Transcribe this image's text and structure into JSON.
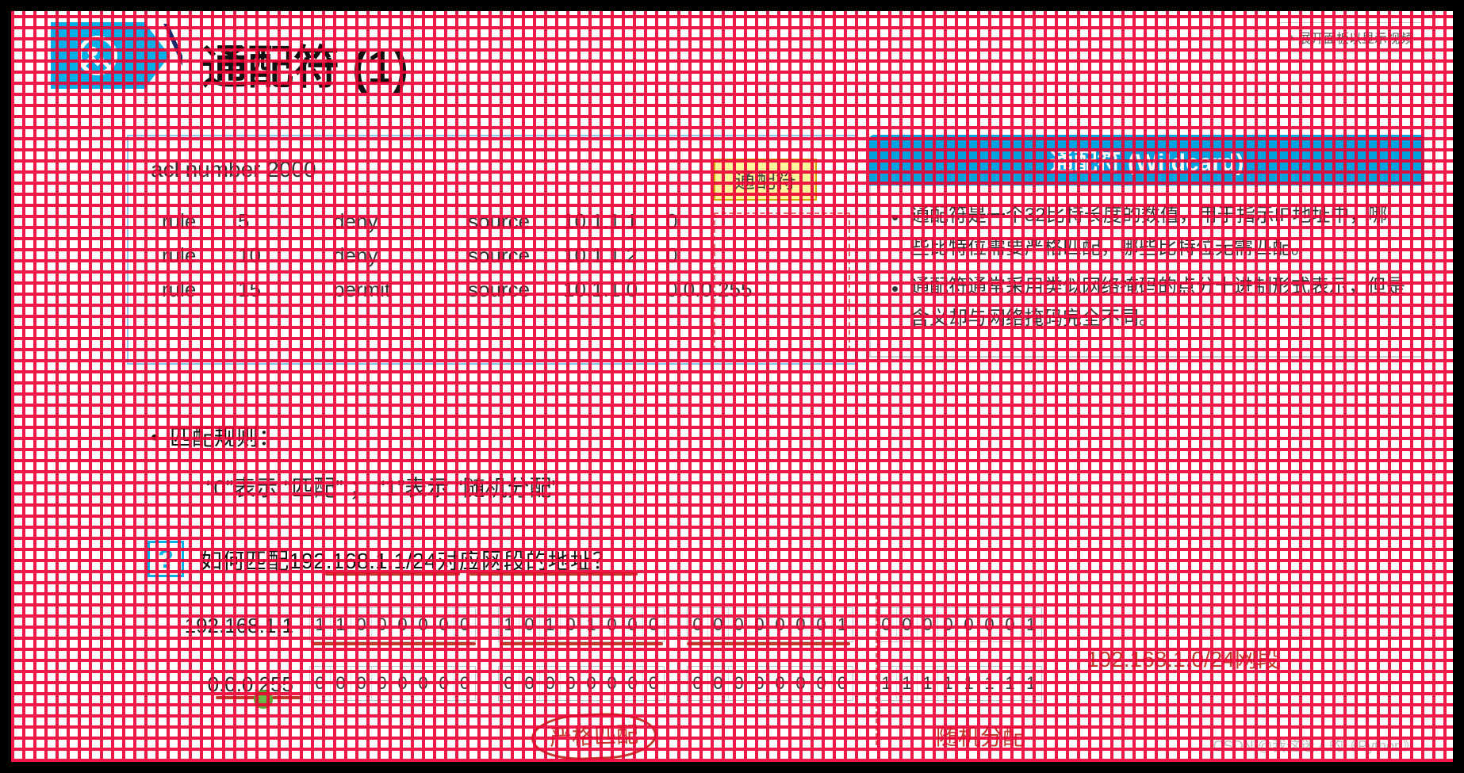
{
  "header": {
    "title": "通配符 (1)",
    "expand_btn": "展开面板以显示视频"
  },
  "acl": {
    "header": "acl number 2000",
    "tag": "通配符",
    "rows": [
      {
        "kw": "rule",
        "id": "5",
        "act": "deny",
        "src": "source",
        "ip": "10.1.1.1",
        "wc": "0"
      },
      {
        "kw": "rule",
        "id": "10",
        "act": "deny",
        "src": "source",
        "ip": "10.1.1.2",
        "wc": "0"
      },
      {
        "kw": "rule",
        "id": "15",
        "act": "permit",
        "src": "source",
        "ip": "10.1.1.0",
        "wc": "0.0.0.255"
      }
    ]
  },
  "panel": {
    "title": "通配符 (Wildcard)",
    "items": [
      "通配符是一个32比特长度的数值，用于指示IP地址中，哪些比特位需要严格匹配，哪些比特位无需匹配。",
      "通配符通常采用类似网络掩码的点分十进制形式表示，但是含义却与网络掩码完全不同。"
    ]
  },
  "rules": {
    "heading": "匹配规则：",
    "text": "“0”表示 “匹配” ；  “1”表示 “随机分配”"
  },
  "question": {
    "mark": "?",
    "text": "如何匹配192.168.1.1/24对应网段的地址？"
  },
  "bitrows": {
    "label1": "192.168.1.1",
    "label2": "0.0.0.255",
    "r1": [
      [
        "1",
        "1",
        "0",
        "0",
        "0",
        "0",
        "0",
        "0"
      ],
      [
        "1",
        "0",
        "1",
        "0",
        "1",
        "0",
        "0",
        "0"
      ],
      [
        "0",
        "0",
        "0",
        "0",
        "0",
        "0",
        "0",
        "1"
      ],
      [
        "0",
        "0",
        "0",
        "0",
        "0",
        "0",
        "0",
        "1"
      ]
    ],
    "r2": [
      [
        "0",
        "0",
        "0",
        "0",
        "0",
        "0",
        "0",
        "0"
      ],
      [
        "0",
        "0",
        "0",
        "0",
        "0",
        "0",
        "0",
        "0"
      ],
      [
        "0",
        "0",
        "0",
        "0",
        "0",
        "0",
        "0",
        "0"
      ],
      [
        "1",
        "1",
        "1",
        "1",
        "1",
        "1",
        "1",
        "1"
      ]
    ]
  },
  "annot": {
    "strict": "严格匹配",
    "random": "随机分配",
    "segment": "192.168.1.0/24网段"
  },
  "watermark": "CSDN @我这迷人的《Python》"
}
